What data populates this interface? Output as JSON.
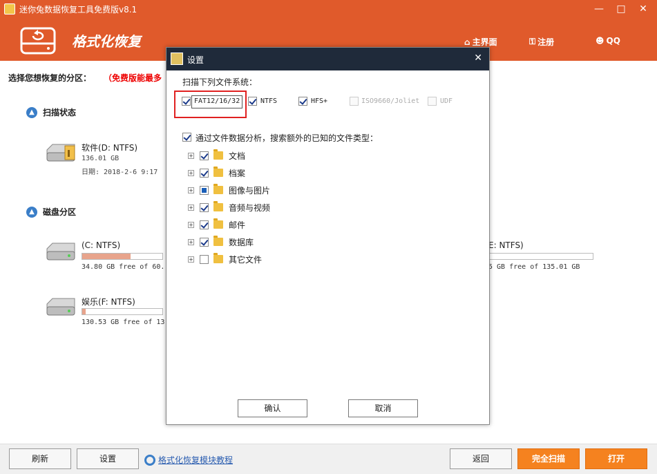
{
  "window": {
    "title": "迷你兔数据恢复工具免费版v8.1",
    "minimize": "—",
    "maximize": "□",
    "close": "✕"
  },
  "header": {
    "section_title": "格式化恢复",
    "nav": [
      {
        "label": "主界面",
        "icon": "home-icon"
      },
      {
        "label": "注册",
        "icon": "key-icon"
      },
      {
        "label": "QQ",
        "icon": "qq-icon"
      }
    ]
  },
  "main": {
    "choose_label": "选择您想恢复的分区：",
    "choose_warning": "（免费版能最多",
    "scan_status_title": "扫描状态",
    "scan_drive": {
      "name": "软件(D: NTFS)",
      "size": "136.01 GB",
      "date": "日期: 2018-2-6 9:17"
    },
    "disk_partition_title": "磁盘分区",
    "partitions": [
      {
        "name": "(C: NTFS)",
        "free": "34.80 GB free of 60.",
        "fill": 0.6
      },
      {
        "name": "E: NTFS)",
        "free": "5 GB free of 135.01 GB",
        "fill": 0.0
      },
      {
        "name": "娱乐(F: NTFS)",
        "free": "130.53 GB free of 13",
        "fill": 0.04
      }
    ]
  },
  "toolbar": {
    "refresh": "刷新",
    "settings": "设置",
    "tutorial": "格式化恢复模块教程",
    "back": "返回",
    "full_scan": "完全扫描",
    "open": "打开"
  },
  "dialog": {
    "title": "设置",
    "close": "✕",
    "fs_label": "扫描下列文件系统：",
    "fs": [
      {
        "label": "FAT12/16/32",
        "checked": true
      },
      {
        "label": "NTFS",
        "checked": true
      },
      {
        "label": "HFS+",
        "checked": true
      },
      {
        "label": "ISO9660/Joliet",
        "checked": false,
        "disabled": true
      },
      {
        "label": "UDF",
        "checked": false,
        "disabled": true
      }
    ],
    "analysis_label": "通过文件数据分析，搜索额外的已知的文件类型：",
    "types": [
      {
        "label": "文档",
        "state": "checked"
      },
      {
        "label": "档案",
        "state": "checked"
      },
      {
        "label": "图像与图片",
        "state": "partial"
      },
      {
        "label": "音频与视频",
        "state": "checked"
      },
      {
        "label": "邮件",
        "state": "checked"
      },
      {
        "label": "数据库",
        "state": "checked"
      },
      {
        "label": "其它文件",
        "state": "unchecked"
      }
    ],
    "ok": "确认",
    "cancel": "取消"
  },
  "colors": {
    "accent": "#e05a2b",
    "dialog_title": "#1f2a3a",
    "highlight": "#e02020",
    "action": "#f5821f"
  }
}
